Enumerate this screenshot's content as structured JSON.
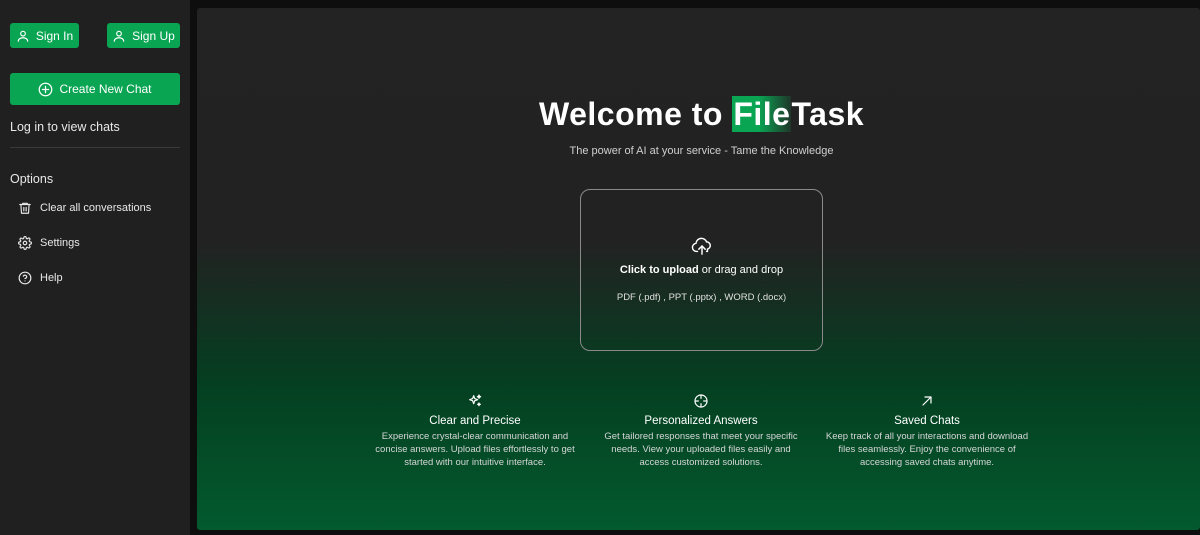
{
  "colors": {
    "accent": "#0aa553",
    "sidebar_bg": "#202020",
    "main_bg_top": "#232323",
    "main_bg_bottom": "#035a2e"
  },
  "sidebar": {
    "sign_in": {
      "label": "Sign In",
      "icon": "user-icon"
    },
    "sign_up": {
      "label": "Sign Up",
      "icon": "user-icon"
    },
    "new_chat": {
      "label": "Create New Chat",
      "icon": "plus-circle-icon"
    },
    "login_note": "Log in to view chats",
    "options_title": "Options",
    "options": [
      {
        "label": "Clear all conversations",
        "icon": "trash-icon"
      },
      {
        "label": "Settings",
        "icon": "gear-icon"
      },
      {
        "label": "Help",
        "icon": "help-circle-icon"
      }
    ]
  },
  "main": {
    "title_prefix": "Welcome to ",
    "title_highlight": "File",
    "title_suffix": "Task",
    "subtitle": "The power of AI at your service - Tame the Knowledge",
    "upload": {
      "icon": "cloud-upload-icon",
      "action": "Click to upload",
      "rest": " or drag and drop",
      "types": "PDF (.pdf) , PPT (.pptx) , WORD (.docx)"
    },
    "features": [
      {
        "icon": "sparkles-icon",
        "title": "Clear and Precise",
        "desc": "Experience crystal-clear communication and concise answers. Upload files effortlessly to get started with our intuitive interface."
      },
      {
        "icon": "crosshair-icon",
        "title": "Personalized Answers",
        "desc": "Get tailored responses that meet your specific needs. View your uploaded files easily and access customized solutions."
      },
      {
        "icon": "arrow-up-right-icon",
        "title": "Saved Chats",
        "desc": "Keep track of all your interactions and download files seamlessly. Enjoy the convenience of accessing saved chats anytime."
      }
    ]
  }
}
